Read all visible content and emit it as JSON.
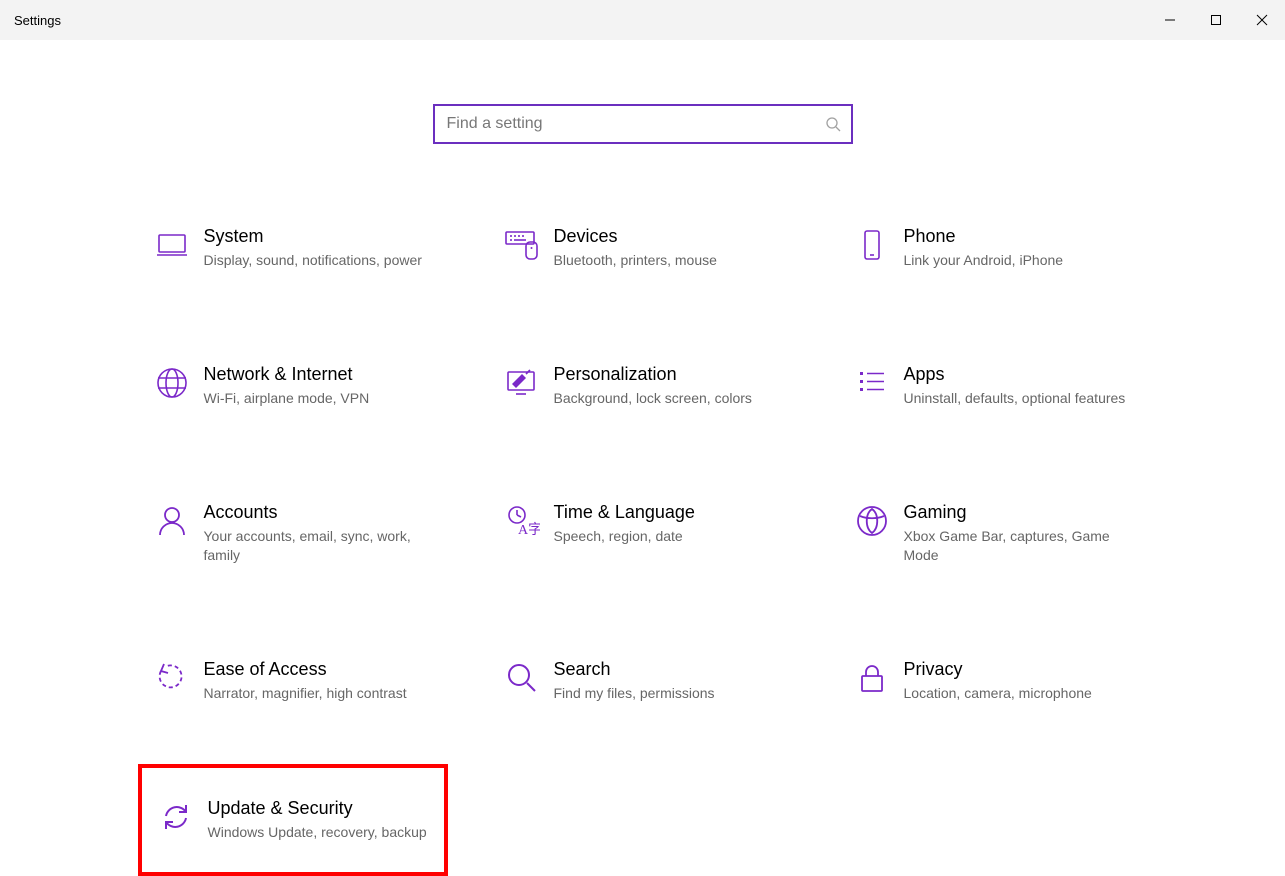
{
  "window": {
    "title": "Settings"
  },
  "search": {
    "placeholder": "Find a setting"
  },
  "tiles": {
    "system": {
      "title": "System",
      "desc": "Display, sound, notifications, power"
    },
    "devices": {
      "title": "Devices",
      "desc": "Bluetooth, printers, mouse"
    },
    "phone": {
      "title": "Phone",
      "desc": "Link your Android, iPhone"
    },
    "network": {
      "title": "Network & Internet",
      "desc": "Wi-Fi, airplane mode, VPN"
    },
    "personalization": {
      "title": "Personalization",
      "desc": "Background, lock screen, colors"
    },
    "apps": {
      "title": "Apps",
      "desc": "Uninstall, defaults, optional features"
    },
    "accounts": {
      "title": "Accounts",
      "desc": "Your accounts, email, sync, work, family"
    },
    "time": {
      "title": "Time & Language",
      "desc": "Speech, region, date"
    },
    "gaming": {
      "title": "Gaming",
      "desc": "Xbox Game Bar, captures, Game Mode"
    },
    "ease": {
      "title": "Ease of Access",
      "desc": "Narrator, magnifier, high contrast"
    },
    "search": {
      "title": "Search",
      "desc": "Find my files, permissions"
    },
    "privacy": {
      "title": "Privacy",
      "desc": "Location, camera, microphone"
    },
    "update": {
      "title": "Update & Security",
      "desc": "Windows Update, recovery, backup"
    }
  }
}
